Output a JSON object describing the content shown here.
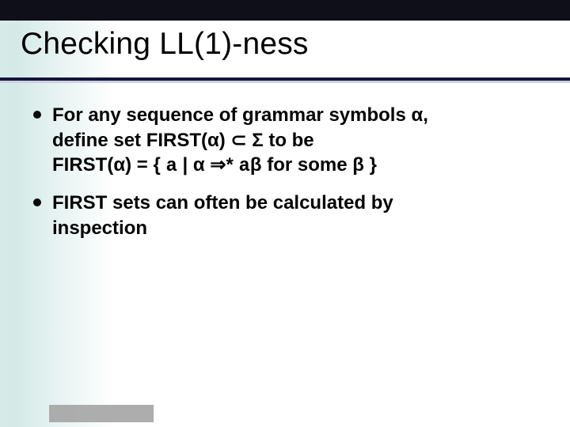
{
  "slide": {
    "title": "Checking LL(1)-ness",
    "bullets": [
      {
        "line1_pre": "For any sequence of grammar symbols ",
        "line1_sym": "α",
        "line1_post": ",",
        "line2_pre": "define set FIRST(",
        "line2_a": "α",
        "line2_mid": ") ",
        "line2_subset": "⊂",
        "line2_sp": " ",
        "line2_sigma": "Σ",
        "line2_post": " to be",
        "line3_pre": "FIRST(",
        "line3_a": "α",
        "line3_mid": ") = { ",
        "line3_tt1": "a",
        "line3_mid2": " | ",
        "line3_alpha2": "α",
        "line3_sp2": " ",
        "line3_impl": "⇒",
        "line3_star": "* ",
        "line3_tt2": "a",
        "line3_beta": "β",
        "line3_mid3": " for some ",
        "line3_beta2": "β",
        "line3_end": " }"
      },
      {
        "line1": "FIRST sets can often be calculated by",
        "line2": "inspection"
      }
    ]
  }
}
